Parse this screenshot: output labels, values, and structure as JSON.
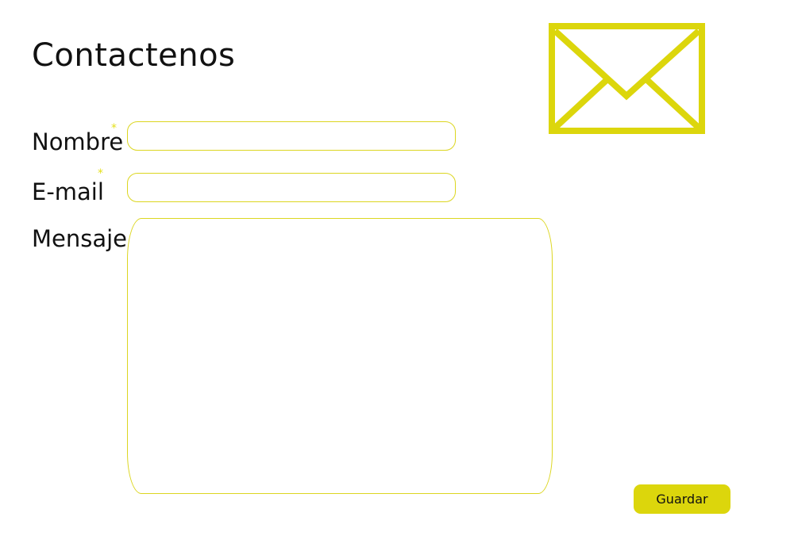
{
  "page": {
    "title": "Contactenos"
  },
  "form": {
    "name_label": "Nombre",
    "email_label": "E-mail",
    "message_label": "Mensaje",
    "required_marker": "*",
    "name_value": "",
    "email_value": "",
    "message_value": "",
    "save_label": "Guardar"
  },
  "icons": {
    "header_icon": "envelope-icon"
  },
  "colors": {
    "accent": "#dcd60c",
    "required": "#e4e01b",
    "text": "#111111"
  }
}
